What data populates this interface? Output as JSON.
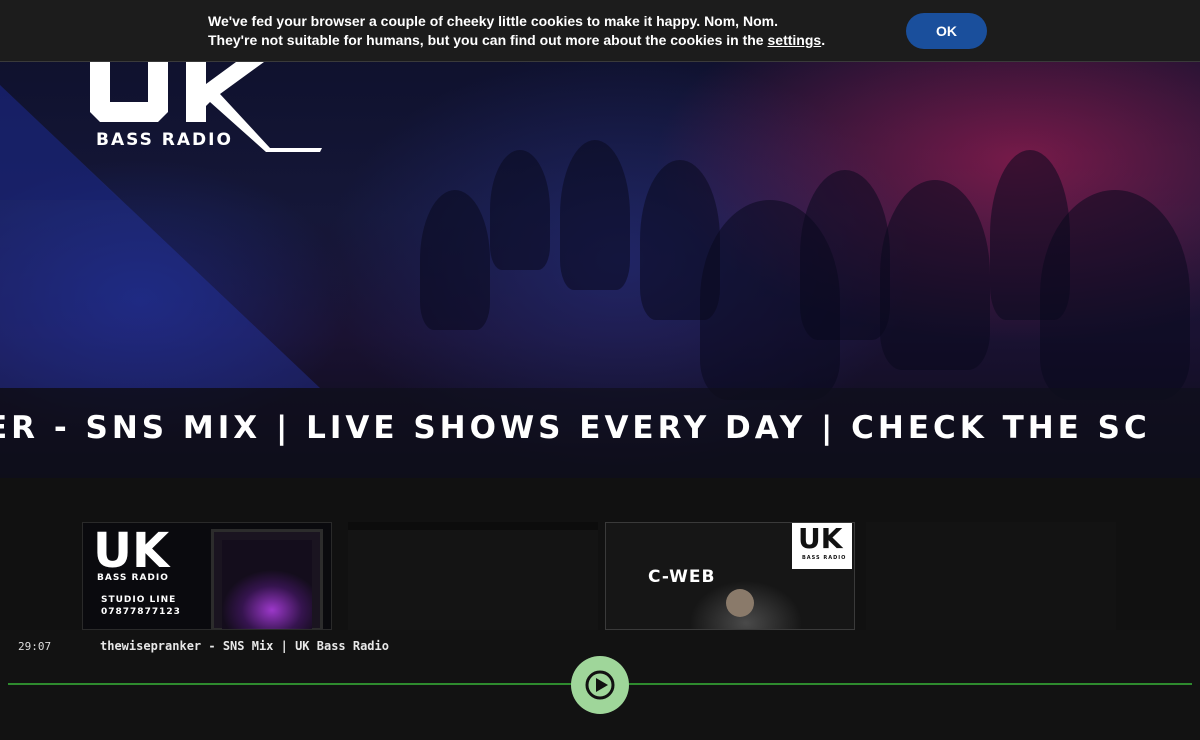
{
  "cookie_bar": {
    "message_line1": "We've fed your browser a couple of cheeky little cookies to make it happy. Nom, Nom.",
    "message_line2_prefix": "They're not suitable for humans, but you can find out more about the cookies in the ",
    "settings_link": "settings",
    "message_line2_suffix": ".",
    "ok_label": "OK",
    "ok_color": "#1a4f9c"
  },
  "hero": {
    "logo_text": "UK",
    "logo_subtitle": "BASS RADIO",
    "ticker_text": "ER - SNS MIX | LIVE SHOWS EVERY DAY | CHECK THE SC"
  },
  "cards": [
    {
      "logo_text": "UK",
      "logo_subtitle": "BASS RADIO",
      "studio_label": "STUDIO LINE",
      "studio_number": "07877877123"
    },
    {},
    {
      "logo_text": "UK",
      "logo_subtitle": "BASS RADIO",
      "dj_name": "C-WEB"
    },
    {}
  ],
  "player": {
    "time": "29:07",
    "track_title": "thewisepranker - SNS Mix | UK Bass Radio",
    "play_icon": "play-icon",
    "progress_color": "#2e8b2e",
    "button_color": "#9fd69a"
  }
}
